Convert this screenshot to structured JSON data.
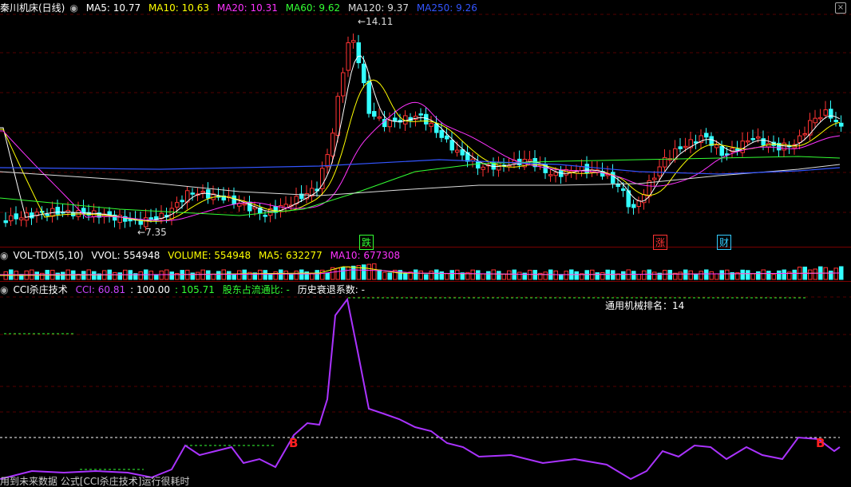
{
  "main_panel": {
    "title": "秦川机床(日线)",
    "indicators": [
      {
        "label": "MA5: 10.77",
        "color": "#ffffff"
      },
      {
        "label": "MA10: 10.63",
        "color": "#ffff00"
      },
      {
        "label": "MA20: 10.31",
        "color": "#ff33ff"
      },
      {
        "label": "MA60: 9.62",
        "color": "#33ff33"
      },
      {
        "label": "MA120: 9.37",
        "color": "#dddddd"
      },
      {
        "label": "MA250: 9.26",
        "color": "#3355ff"
      }
    ],
    "high_label": "14.11",
    "low_label": "7.35",
    "tags": [
      {
        "text": "跌",
        "color": "#33ff33"
      },
      {
        "text": "涨",
        "color": "#ff3333"
      },
      {
        "text": "财",
        "color": "#33ccff"
      }
    ]
  },
  "volume_panel": {
    "title": "VOL-TDX(5,10)",
    "indicators": [
      {
        "label": "VVOL: 554948",
        "color": "#ffffff"
      },
      {
        "label": "VOLUME: 554948",
        "color": "#ffff00"
      },
      {
        "label": "MA5: 632277",
        "color": "#ffff00"
      },
      {
        "label": "MA10: 677308",
        "color": "#ff33ff"
      }
    ]
  },
  "cci_panel": {
    "title": "CCI杀庄技术",
    "indicators": [
      {
        "label": "CCI: 60.81",
        "color": "#cc44ff"
      },
      {
        "label": ": 100.00",
        "color": "#ffffff"
      },
      {
        "label": ": 105.71",
        "color": "#33ff33"
      },
      {
        "label": "股东占流通比: -",
        "color": "#33ff33"
      },
      {
        "label": "历史衰退系数: -",
        "color": "#ffffff"
      }
    ],
    "ranking_label": "通用机械排名：",
    "ranking_value": "14",
    "buy_mark": "B"
  },
  "footer": "用到未来数据  公式[CCI杀庄技术]运行很耗时",
  "icons": {
    "corner": "close-icon"
  },
  "colors": {
    "up": "#ff3333",
    "down": "#33ffff",
    "panel_border": "#7a0000",
    "cci_line": "#aa33ff"
  }
}
